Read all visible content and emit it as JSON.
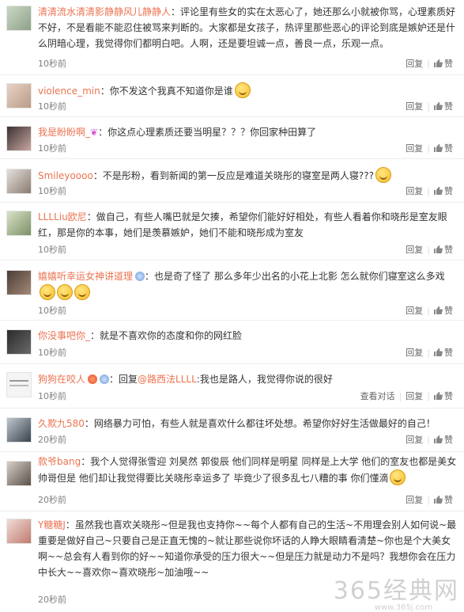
{
  "labels": {
    "reply": "回复",
    "like": "赞",
    "view_conversation": "查看对话"
  },
  "colors": {
    "username": "#eb7350",
    "time": "#808080"
  },
  "comments": [
    {
      "user": "清清流水清清影静静风儿静静人",
      "text": "：评论里有些女的实在太恶心了，她还那么小就被你骂，心理素质好不好，不是看能不能忍住被骂来判断的。大家都是女孩子，热评里那些恶心的评论到底是嫉妒还是什么阴暗心理，我觉得你们都明白吧。人啊，还是要坦诚一点，善良一点，乐观一点。",
      "time": "10秒前"
    },
    {
      "user": "violence_min",
      "text": "：你不发这个我真不知道你是谁",
      "time": "10秒前",
      "emoji": "smile-emoji"
    },
    {
      "user": "我是盼盼啊_",
      "text": "：你这点心理素质还要当明星？？？你回家种田算了",
      "time": "10秒前"
    },
    {
      "user": "Smileyoooo",
      "text": "：不是彤粉，看到新闻的第一反应是难道关晓彤的寝室是两人寝???",
      "time": "10秒前",
      "emoji": "think-emoji"
    },
    {
      "user": "LLLLiu欧尼",
      "text": "：做自己，有些人嘴巴就是欠揍，希望你们能好好相处，有些人看着你和晓彤是室友眼红，那是你的本事，她们是羡慕嫉妒，她们不能和晓彤成为室友",
      "time": "10秒前"
    },
    {
      "user": "嬉嬉听幸运女神讲道理",
      "text": "：也是奇了怪了 那么多年少出名的小花上北影 怎么就你们寝室这么多戏",
      "time": "10秒前"
    },
    {
      "user": "你没事吧你_",
      "text": "：就是不喜欢你的态度和你的网红脸",
      "time": "10秒前"
    },
    {
      "user": "狗狗在咬人",
      "text_prefix": "：回复",
      "mention": "@路西法LLLL",
      "text": ":我也是路人，我觉得你说的很好",
      "time": "10秒前"
    },
    {
      "user": "久欺九580",
      "text": "：网络暴力可怕，有些人就是喜欢什么都往坏处想。希望你好好生活做最好的自己！",
      "time": "20秒前"
    },
    {
      "user": "款爷bang",
      "text": "：我个人觉得张雪迎 刘昊然 郭俊辰 他们同样是明星 同样是上大学 他们的室友也都是美女帅哥但是 他们却让我觉得要比关晓彤幸运多了 毕竟少了很多乱七八糟的事 你们懂滴",
      "time": "20秒前"
    },
    {
      "user": "Y糖糖J",
      "text": "：虽然我也喜欢关晓彤~但是我也支持你~~每个人都有自己的生活~不用理会别人如何说~最重要是做好自己~只要自己是正直无愧的~就让那些说你坏话的人睁大眼睛看清楚~你也是个大美女啊~~总会有人看到你的好~~知道你承受的压力很大~~但是压力就是动力不是吗？我想你会在压力中长大~~喜欢你~喜欢晓彤~加油哦~~",
      "time": "20秒前"
    }
  ],
  "watermark": {
    "main": "365经典网",
    "sub": "www.365j.com"
  }
}
